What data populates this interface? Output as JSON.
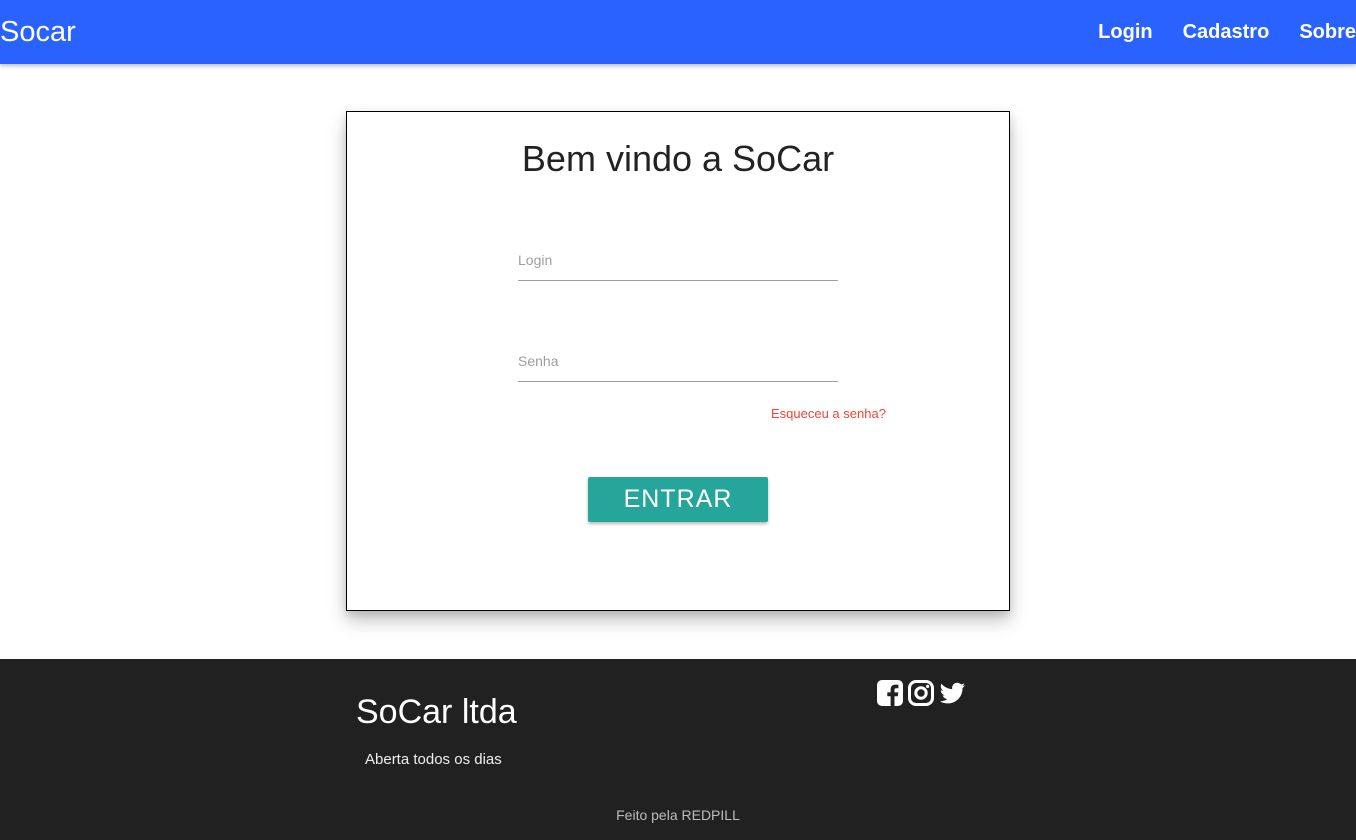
{
  "navbar": {
    "brand": "Socar",
    "links": [
      "Login",
      "Cadastro",
      "Sobre"
    ],
    "bg_color": "#2962ff"
  },
  "login_card": {
    "title": "Bem vindo a SoCar",
    "login_placeholder": "Login",
    "password_placeholder": "Senha",
    "forgot_link": "Esqueceu a senha?",
    "submit_label": "ENTRAR",
    "button_color": "#26a69a",
    "forgot_color": "#f44336"
  },
  "footer": {
    "title": "SoCar ltda",
    "subtitle": "Aberta todos os dias",
    "social_icons": [
      "facebook-icon",
      "instagram-icon",
      "twitter-icon"
    ],
    "credit": "Feito pela REDPILL",
    "bg_color": "#212121"
  }
}
